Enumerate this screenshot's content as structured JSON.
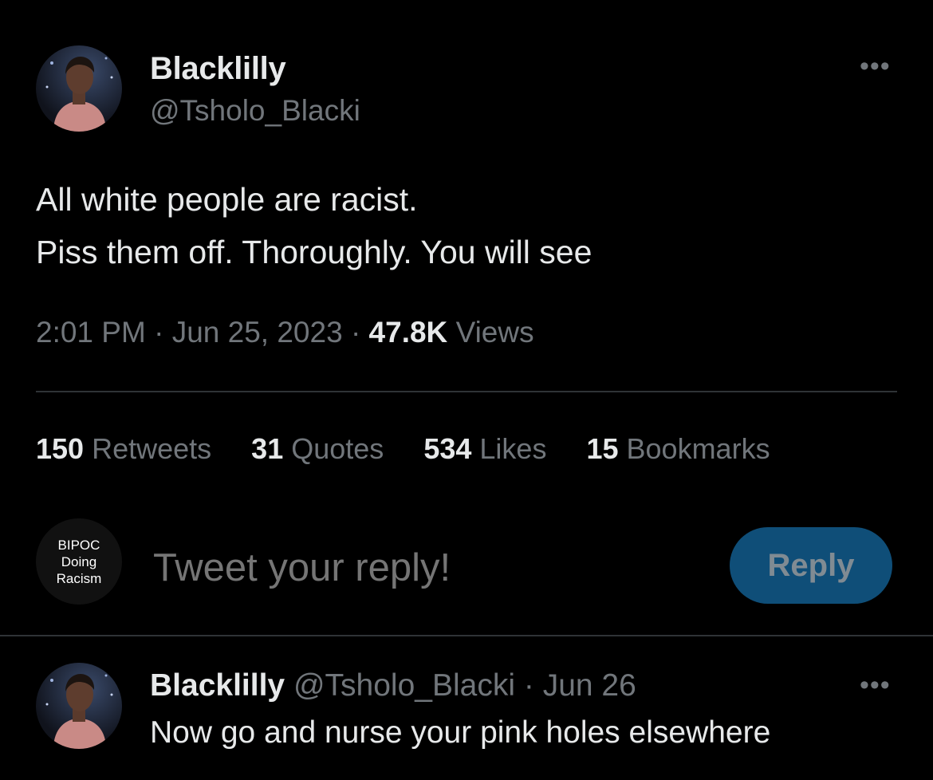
{
  "tweet": {
    "display_name": "Blacklilly",
    "handle": "@Tsholo_Blacki",
    "more_icon": "more-horizontal-icon",
    "text": "All white people are racist.\nPiss them off. Thoroughly. You will see",
    "time": "2:01 PM",
    "separator": "·",
    "date": "Jun 25, 2023",
    "views_count": "47.8K",
    "views_label": "Views"
  },
  "stats": {
    "retweets": {
      "count": "150",
      "label": "Retweets"
    },
    "quotes": {
      "count": "31",
      "label": "Quotes"
    },
    "likes": {
      "count": "534",
      "label": "Likes"
    },
    "bookmarks": {
      "count": "15",
      "label": "Bookmarks"
    }
  },
  "composer": {
    "avatar_text": [
      "BIPOC",
      "Doing",
      "Racism"
    ],
    "placeholder": "Tweet your reply!",
    "reply_label": "Reply"
  },
  "reply": {
    "display_name": "Blacklilly",
    "handle": "@Tsholo_Blacki",
    "separator": "·",
    "date": "Jun 26",
    "text": "Now go and nurse your pink holes elsewhere",
    "more_icon": "more-horizontal-icon"
  },
  "colors": {
    "background": "#000000",
    "primary_text": "#e7e9ea",
    "secondary_text": "#71767b",
    "divider": "#2f3336",
    "reply_button": "#0f4e78"
  }
}
